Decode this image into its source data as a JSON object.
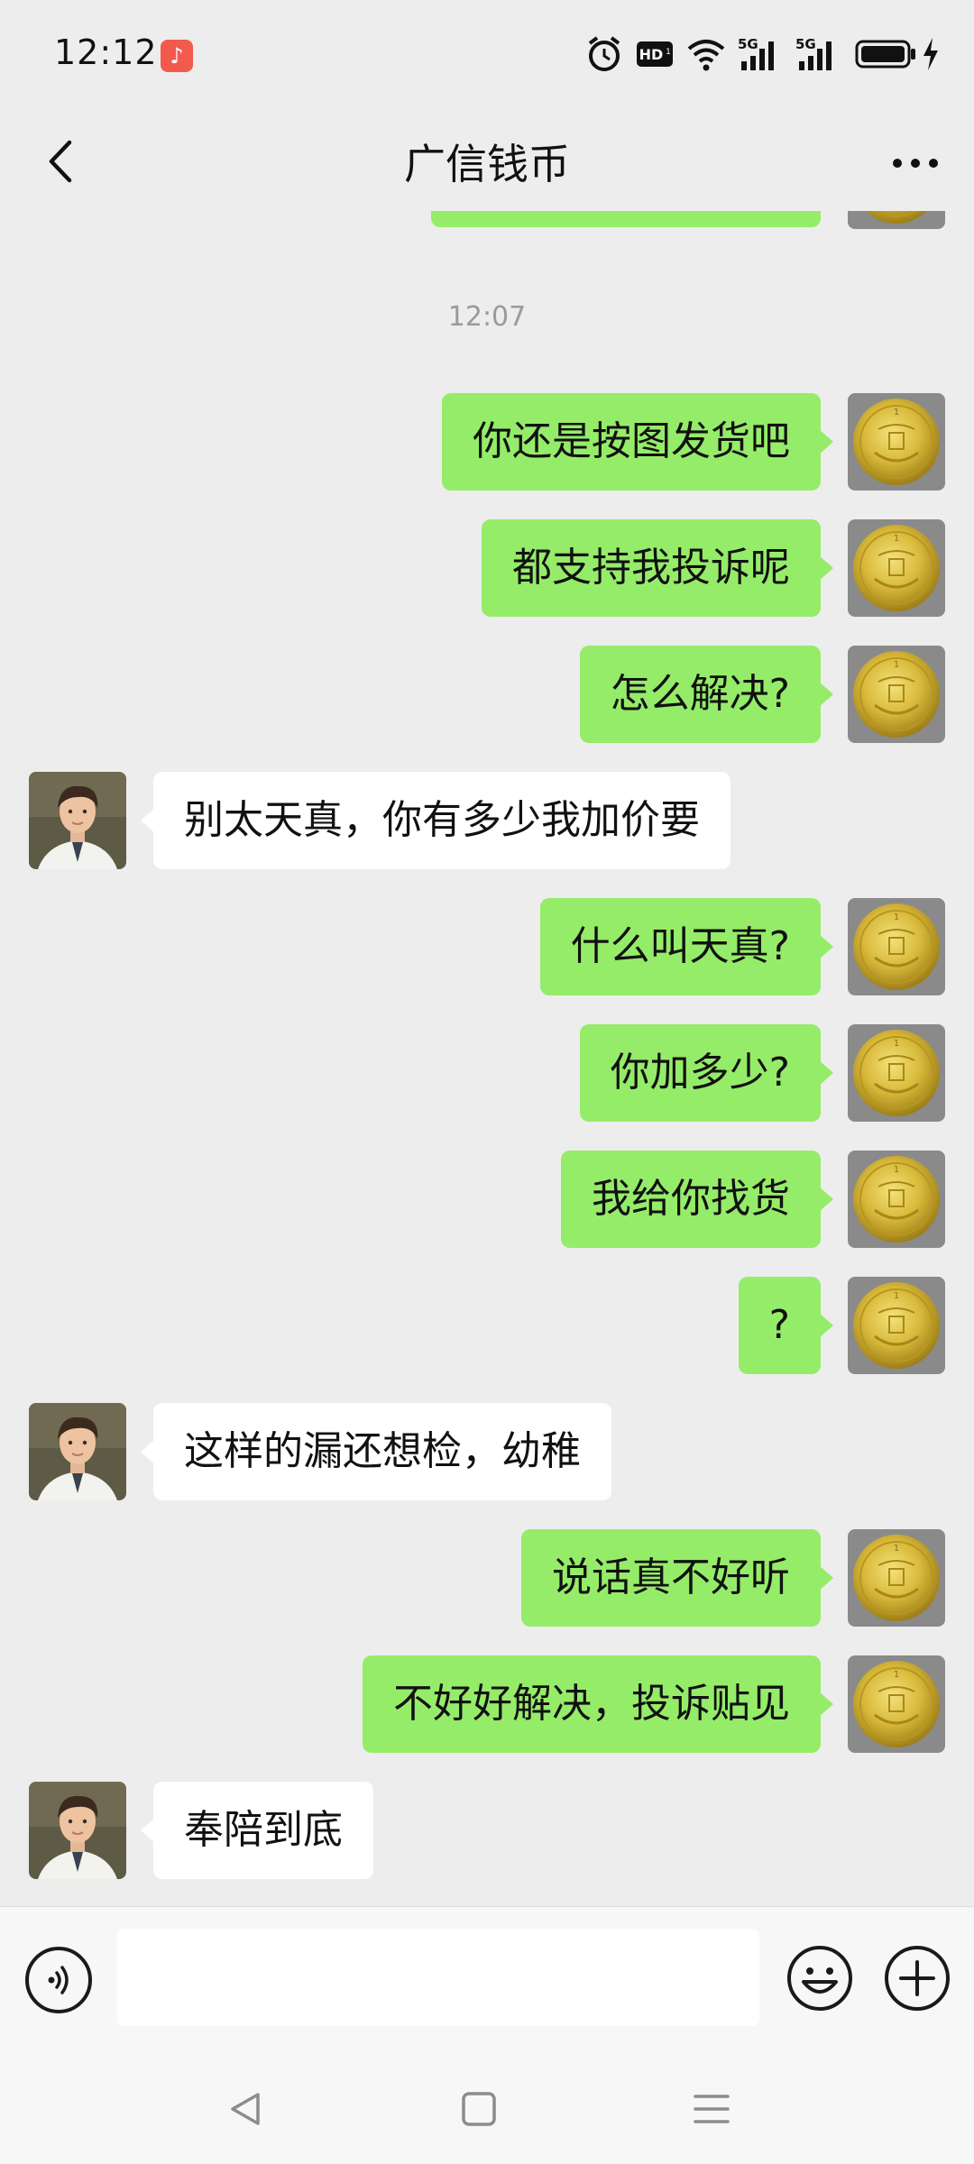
{
  "status_bar": {
    "time": "12:12",
    "music_icon": "music-note-icon",
    "icons": [
      "alarm-icon",
      "hd-icon",
      "wifi-icon",
      "signal-5g-icon",
      "signal-5g-icon",
      "battery-icon",
      "charging-icon"
    ]
  },
  "nav": {
    "title": "广信钱币",
    "back_icon": "chevron-left-icon",
    "more_icon": "more-icon"
  },
  "chat": {
    "timestamp": "12:07",
    "messages": [
      {
        "from": "me",
        "text": "你还是按图发货吧"
      },
      {
        "from": "me",
        "text": "都支持我投诉呢"
      },
      {
        "from": "me",
        "text": "怎么解决?"
      },
      {
        "from": "them",
        "text": "别太天真，你有多少我加价要"
      },
      {
        "from": "me",
        "text": "什么叫天真?"
      },
      {
        "from": "me",
        "text": "你加多少?"
      },
      {
        "from": "me",
        "text": "我给你找货"
      },
      {
        "from": "me",
        "text": "?"
      },
      {
        "from": "them",
        "text": "这样的漏还想检，幼稚"
      },
      {
        "from": "me",
        "text": "说话真不好听"
      },
      {
        "from": "me",
        "text": "不好好解决，投诉贴见"
      },
      {
        "from": "them",
        "text": "奉陪到底"
      }
    ]
  },
  "input_bar": {
    "value": "",
    "voice_icon": "voice-icon",
    "emoji_icon": "emoji-icon",
    "plus_icon": "plus-icon"
  },
  "system_nav": {
    "back_icon": "nav-back-icon",
    "home_icon": "nav-home-icon",
    "menu_icon": "nav-menu-icon"
  },
  "colors": {
    "background": "#ededed",
    "my_bubble": "#95ec69",
    "their_bubble": "#ffffff",
    "timestamp": "#9a9a9a"
  }
}
